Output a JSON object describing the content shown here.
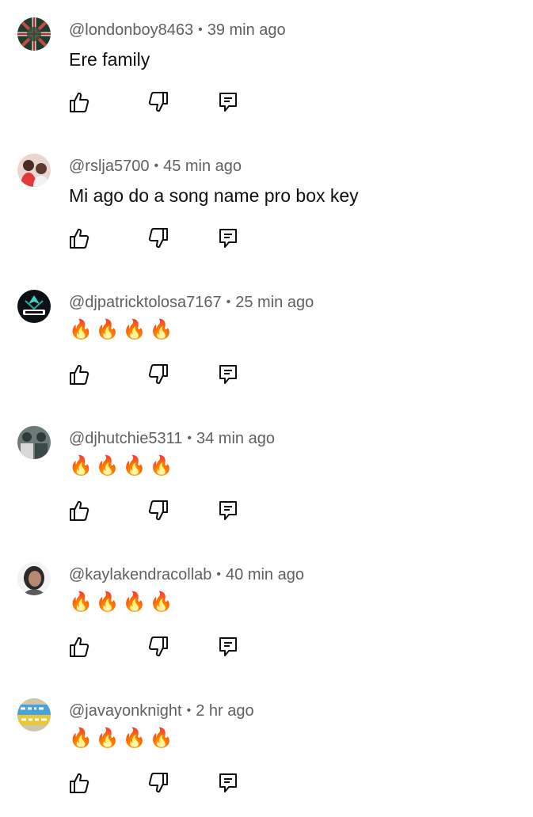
{
  "comments": [
    {
      "author": "@londonboy8463",
      "time": "39 min ago",
      "text": "Ere family",
      "emoji": false,
      "avatar_icon": "flag-avatar"
    },
    {
      "author": "@rslja5700",
      "time": "45 min ago",
      "text": "Mi ago do a song name pro box key",
      "emoji": false,
      "avatar_icon": "photo-avatar"
    },
    {
      "author": "@djpatricktolosa7167",
      "time": "25 min ago",
      "text": "🔥🔥🔥🔥",
      "emoji": true,
      "avatar_icon": "dj-logo-avatar"
    },
    {
      "author": "@djhutchie5311",
      "time": "34 min ago",
      "text": "🔥🔥🔥🔥",
      "emoji": true,
      "avatar_icon": "photo-avatar"
    },
    {
      "author": "@kaylakendracollab",
      "time": "40 min ago",
      "text": "🔥🔥🔥🔥",
      "emoji": true,
      "avatar_icon": "photo-avatar"
    },
    {
      "author": "@javayonknight",
      "time": "2 hr ago",
      "text": "🔥🔥🔥🔥",
      "emoji": true,
      "avatar_icon": "daily-videos-avatar"
    }
  ],
  "icons": {
    "like": "thumbs-up-icon",
    "dislike": "thumbs-down-icon",
    "reply": "reply-icon"
  },
  "colors": {
    "meta": "#606060",
    "text": "#0f0f0f"
  }
}
